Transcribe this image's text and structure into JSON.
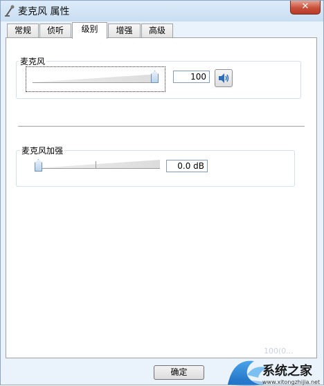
{
  "window": {
    "title": "麦克风 属性",
    "close_glyph": "✕",
    "title_icon": "microphone-icon"
  },
  "tabs": [
    {
      "label": "常规"
    },
    {
      "label": "侦听"
    },
    {
      "label": "级别",
      "active": true
    },
    {
      "label": "增强"
    },
    {
      "label": "高级"
    }
  ],
  "levels": {
    "microphone": {
      "label": "麦克风",
      "value": "100",
      "level_fraction": 1.0,
      "mute_icon": "speaker-icon"
    },
    "boost": {
      "label": "麦克风加强",
      "value": "0.0 dB",
      "level_fraction": 0.0
    }
  },
  "buttons": {
    "ok": "确定"
  },
  "watermark": {
    "brand": "系统之家",
    "url": "www.xitongzhijia.net",
    "faint_text": "100(0..."
  },
  "colors": {
    "window_bg": "#eaf3fb",
    "close_red": "#c7503a",
    "accent_blue": "#2a7fd4"
  }
}
